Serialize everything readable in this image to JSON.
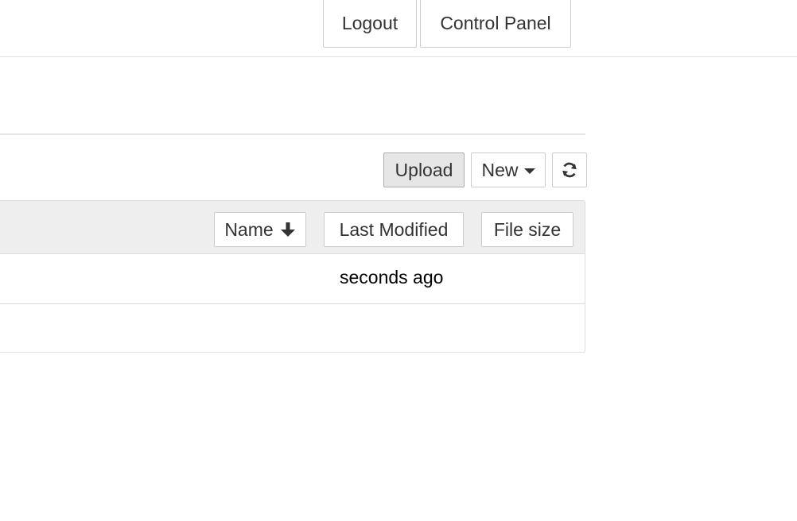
{
  "header": {
    "logout_label": "Logout",
    "control_panel_label": "Control Panel"
  },
  "toolbar": {
    "upload_label": "Upload",
    "new_label": "New",
    "new_icon": "caret-down-icon",
    "refresh_icon": "refresh-icon"
  },
  "list": {
    "columns": {
      "name_label": "Name",
      "name_sort_icon": "arrow-down-icon",
      "last_modified_label": "Last Modified",
      "file_size_label": "File size"
    },
    "rows": [
      {
        "name": "",
        "last_modified": "seconds ago",
        "file_size": ""
      },
      {
        "name": "",
        "last_modified": "",
        "file_size": ""
      }
    ]
  }
}
